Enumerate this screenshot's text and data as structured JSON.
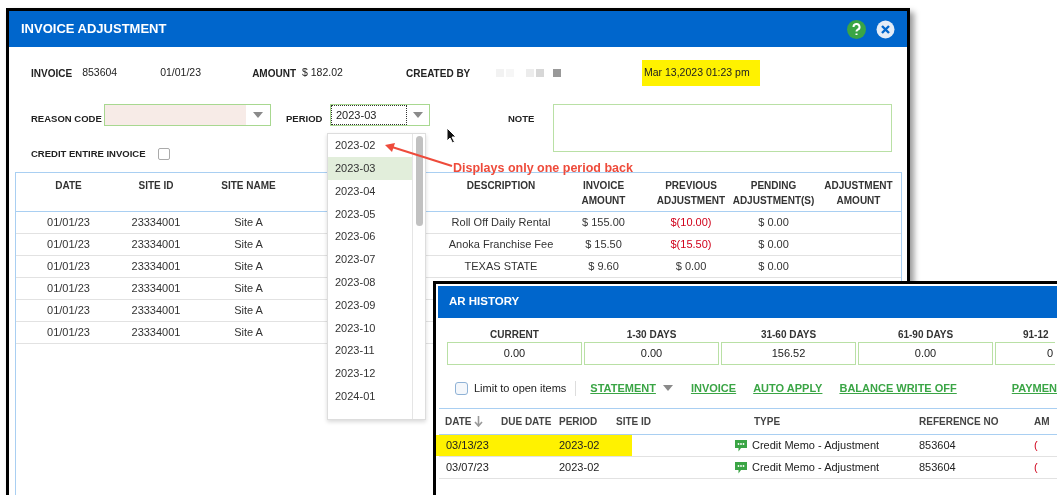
{
  "invoice_window": {
    "title": "INVOICE ADJUSTMENT",
    "header": {
      "invoice_label": "INVOICE",
      "invoice_no": "853604",
      "invoice_date": "01/01/23",
      "amount_label": "AMOUNT",
      "amount": "$ 182.02",
      "created_by_label": "CREATED BY",
      "created_at": "Mar 13,2023 01:23 pm"
    },
    "reason_code_label": "REASON CODE",
    "period_label": "PERIOD",
    "period_value": "2023-03",
    "note_label": "NOTE",
    "credit_entire_label": "CREDIT ENTIRE INVOICE",
    "credit_entire_checked": false,
    "table": {
      "columns": [
        "DATE",
        "SITE ID",
        "SITE NAME",
        "DESCRIPTION",
        "INVOICE AMOUNT",
        "PREVIOUS ADJUSTMENT",
        "PENDING ADJUSTMENT(S)",
        "ADJUSTMENT AMOUNT"
      ],
      "rows": [
        {
          "date": "01/01/23",
          "site_id": "23334001",
          "site_name": "Site A",
          "description": "Roll Off Daily Rental",
          "invoice_amount": "$ 155.00",
          "previous_adjustment": "$(10.00)",
          "pending_adjustment": "$ 0.00"
        },
        {
          "date": "01/01/23",
          "site_id": "23334001",
          "site_name": "Site A",
          "description": "Anoka Franchise Fee",
          "invoice_amount": "$ 15.50",
          "previous_adjustment": "$(15.50)",
          "pending_adjustment": "$ 0.00"
        },
        {
          "date": "01/01/23",
          "site_id": "23334001",
          "site_name": "Site A",
          "description": "TEXAS STATE",
          "invoice_amount": "$ 9.60",
          "previous_adjustment": "$ 0.00",
          "pending_adjustment": "$ 0.00"
        },
        {
          "date": "01/01/23",
          "site_id": "23334001",
          "site_name": "Site A"
        },
        {
          "date": "01/01/23",
          "site_id": "23334001",
          "site_name": "Site A"
        },
        {
          "date": "01/01/23",
          "site_id": "23334001",
          "site_name": "Site A"
        }
      ]
    }
  },
  "period_dropdown": {
    "options": [
      {
        "label": "2023-02",
        "selected": false
      },
      {
        "label": "2023-03",
        "selected": true
      },
      {
        "label": "2023-04",
        "selected": false
      },
      {
        "label": "2023-05",
        "selected": false
      },
      {
        "label": "2023-06",
        "selected": false
      },
      {
        "label": "2023-07",
        "selected": false
      },
      {
        "label": "2023-08",
        "selected": false
      },
      {
        "label": "2023-09",
        "selected": false
      },
      {
        "label": "2023-10",
        "selected": false
      },
      {
        "label": "2023-11",
        "selected": false
      },
      {
        "label": "2023-12",
        "selected": false
      },
      {
        "label": "2024-01",
        "selected": false
      }
    ]
  },
  "annotation": {
    "text": "Displays only one period back"
  },
  "ar_history": {
    "title": "AR HISTORY",
    "aging": [
      {
        "label": "CURRENT",
        "value": "0.00"
      },
      {
        "label": "1-30 DAYS",
        "value": "0.00"
      },
      {
        "label": "31-60 DAYS",
        "value": "156.52"
      },
      {
        "label": "61-90 DAYS",
        "value": "0.00"
      },
      {
        "label": "91-12",
        "value": "0"
      }
    ],
    "limit_label": "Limit to open items",
    "limit_checked": false,
    "actions": [
      {
        "label": "STATEMENT",
        "has_menu": true
      },
      {
        "label": "INVOICE",
        "has_menu": false
      },
      {
        "label": "AUTO APPLY",
        "has_menu": false
      },
      {
        "label": "BALANCE WRITE OFF",
        "has_menu": false
      },
      {
        "label": "PAYMEN",
        "has_menu": false
      }
    ],
    "columns": [
      "DATE",
      "DUE DATE",
      "PERIOD",
      "SITE ID",
      "TYPE",
      "REFERENCE NO",
      "AM"
    ],
    "rows": [
      {
        "date": "03/13/23",
        "period": "2023-02",
        "type": "Credit Memo - Adjustment",
        "reference_no": "853604",
        "amount": "(",
        "highlighted": true
      },
      {
        "date": "03/07/23",
        "period": "2023-02",
        "type": "Credit Memo - Adjustment",
        "reference_no": "853604",
        "amount": "(",
        "highlighted": false
      }
    ]
  }
}
